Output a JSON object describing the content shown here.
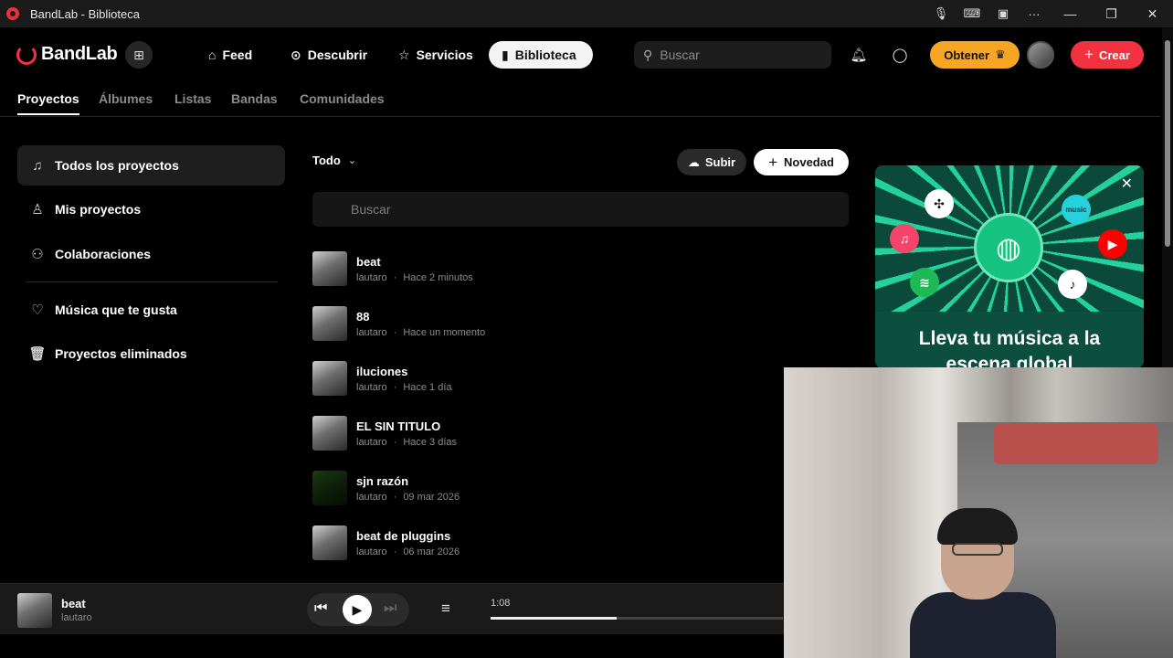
{
  "window": {
    "title": "BandLab - Biblioteca"
  },
  "topnav": {
    "logo": "BandLab",
    "items": [
      {
        "label": "Feed",
        "icon": "home-icon"
      },
      {
        "label": "Descubrir",
        "icon": "compass-icon"
      },
      {
        "label": "Servicios",
        "icon": "star-icon"
      },
      {
        "label": "Biblioteca",
        "icon": "library-icon"
      }
    ],
    "search_placeholder": "Buscar",
    "obtener_label": "Obtener",
    "crear_label": "Crear"
  },
  "subtabs": [
    "Proyectos",
    "Álbumes",
    "Listas",
    "Bandas",
    "Comunidades"
  ],
  "sidebar": {
    "items": [
      {
        "label": "Todos los proyectos",
        "icon": "music-note-icon"
      },
      {
        "label": "Mis proyectos",
        "icon": "user-icon"
      },
      {
        "label": "Colaboraciones",
        "icon": "users-icon"
      },
      {
        "label": "Música que te gusta",
        "icon": "heart-icon"
      },
      {
        "label": "Proyectos eliminados",
        "icon": "trash-icon"
      }
    ]
  },
  "main": {
    "filter_label": "Todo",
    "upload_label": "Subir",
    "new_label": "Novedad",
    "search_placeholder": "Buscar",
    "projects": [
      {
        "title": "beat",
        "artist": "lautaro",
        "time": "Hace 2 minutos"
      },
      {
        "title": "88",
        "artist": "lautaro",
        "time": "Hace un momento"
      },
      {
        "title": "iluciones",
        "artist": "lautaro",
        "time": "Hace 1 día"
      },
      {
        "title": "EL SIN TITULO",
        "artist": "lautaro",
        "time": "Hace 3 días"
      },
      {
        "title": "sjn razón",
        "artist": "lautaro",
        "time": "09 mar 2026"
      },
      {
        "title": "beat de pluggins",
        "artist": "lautaro",
        "time": "06 mar 2026"
      }
    ]
  },
  "promo": {
    "headline_line1": "Lleva tu música a la",
    "headline_line2": "escena global"
  },
  "player": {
    "title": "beat",
    "artist": "lautaro",
    "time": "1:08",
    "progress": 0.43
  },
  "colors": {
    "accent": "#f2323f",
    "obtener": "#f6a623",
    "promo_green": "#16c27f"
  }
}
